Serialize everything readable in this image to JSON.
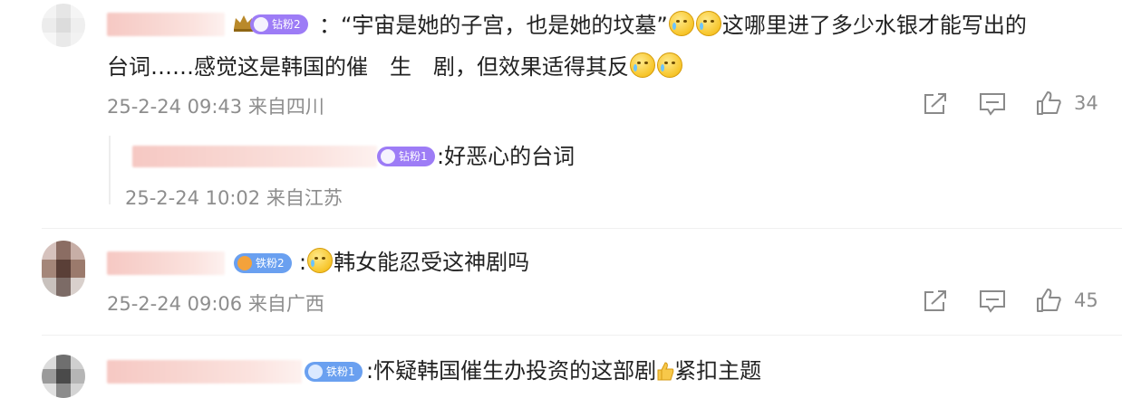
{
  "comments": [
    {
      "badge": "钻粉2",
      "text_line1": "：“宇宙是她的子宫，也是她的坟墓”",
      "text_line1_tail": "这哪里进了多少水银才能写出的",
      "text_line2": "台词……感觉这是韩国的催　生　剧，但效果适得其反",
      "time": "25-2-24 09:43",
      "location": "来自四川",
      "likes": "34",
      "reply": {
        "badge": "钻粉1",
        "text": ":好恶心的台词",
        "time": "25-2-24 10:02",
        "location": "来自江苏"
      }
    },
    {
      "badge": "铁粉2",
      "text_before_emoji": ":",
      "text": "韩女能忍受这神剧吗",
      "time": "25-2-24 09:06",
      "location": "来自广西",
      "likes": "45"
    },
    {
      "badge": "铁粉1",
      "text": ":怀疑韩国催生办投资的这部剧",
      "text_tail": "紧扣主题"
    }
  ],
  "colors": {
    "badge_diamond": "#9d7cf6",
    "badge_iron": "#6aa0f0",
    "meta": "#8d8d8d",
    "icon": "#8a8a8a"
  },
  "icons": [
    "crown-icon",
    "share-icon",
    "comment-icon",
    "like-icon",
    "cry-emoji",
    "thumbs-up-emoji"
  ]
}
